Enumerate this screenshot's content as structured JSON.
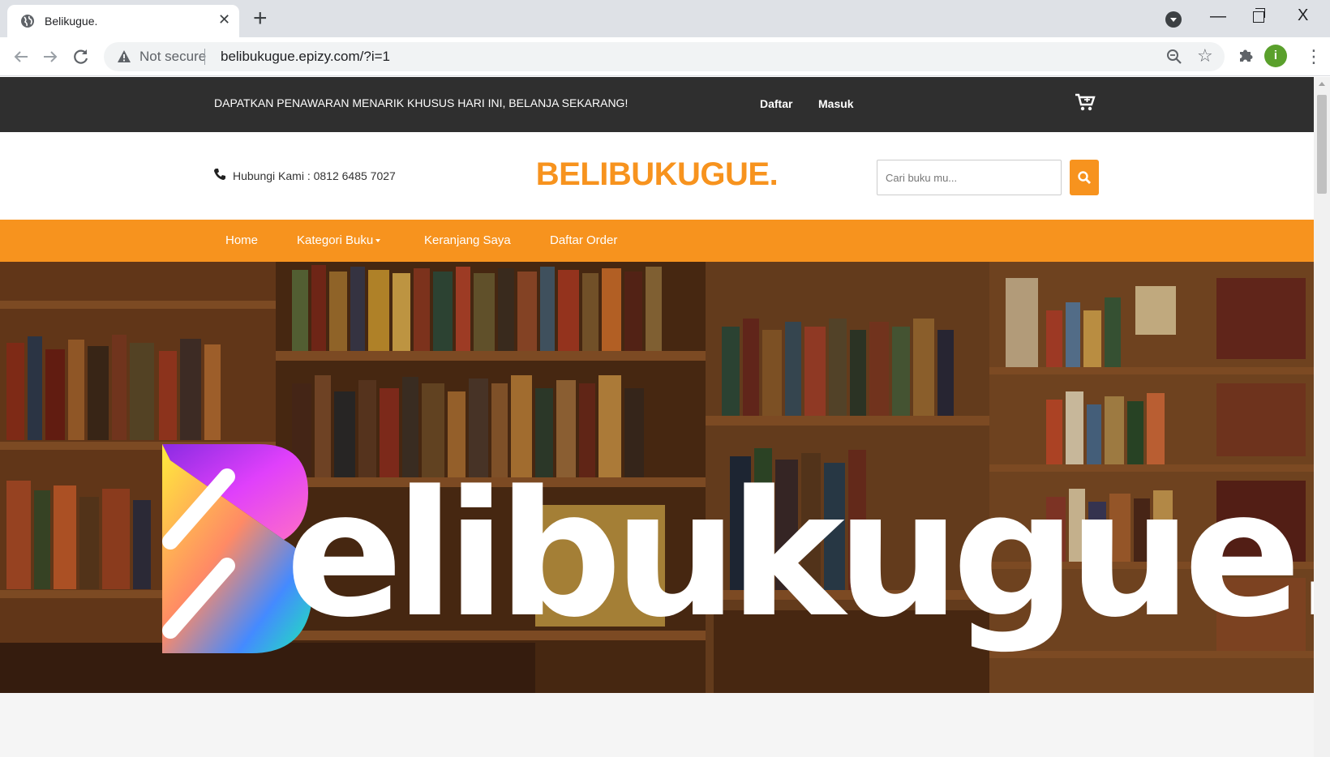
{
  "browser": {
    "tab_title": "Belikugue.",
    "tab_close": "✕",
    "new_tab": "+",
    "security_label": "Not secure",
    "url": "belibukugue.epizy.com/?i=1",
    "profile_initial": "i",
    "window_min": "—",
    "window_close": "X"
  },
  "site": {
    "promo_text": "DAPATKAN PENAWARAN MENARIK KHUSUS HARI INI, BELANJA SEKARANG!",
    "register_link": "Daftar",
    "login_link": "Masuk",
    "contact_text": "Hubungi Kami : 0812 6485 7027",
    "brand_name": "BELIBUKUGUE.",
    "search_placeholder": "Cari buku mu...",
    "nav": {
      "home": "Home",
      "categories": "Kategori Buku",
      "cart": "Keranjang Saya",
      "orders": "Daftar Order"
    },
    "hero_wordmark": "elibukugue."
  },
  "colors": {
    "accent": "#f7931e",
    "topbar": "#2f2f2f",
    "chrome_tabbar": "#dee1e6"
  },
  "icons": {
    "favicon": "globe-icon",
    "back": "back-arrow-icon",
    "forward": "forward-arrow-icon",
    "reload": "reload-icon",
    "security": "warning-triangle-icon",
    "zoom": "zoom-icon",
    "bookmark": "star-icon",
    "extensions": "puzzle-icon",
    "menu": "kebab-menu-icon",
    "cart": "cart-icon",
    "phone": "phone-icon",
    "search": "search-icon"
  }
}
